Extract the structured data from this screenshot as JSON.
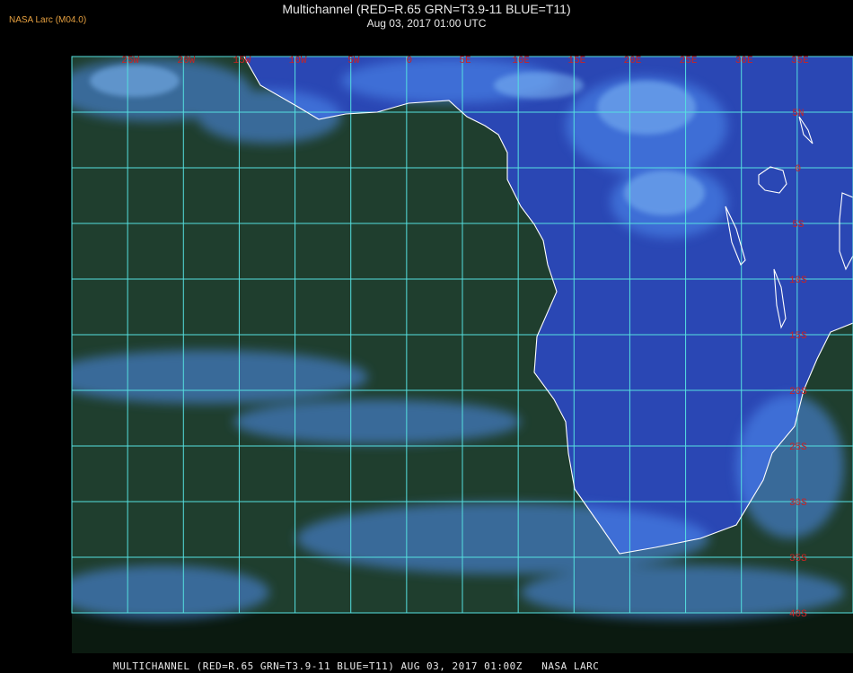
{
  "header": {
    "brand": "NASA Larc (M04.0)",
    "title": "Multichannel (RED=R.65 GRN=T3.9-11 BLUE=T11)",
    "datetime": "Aug 03, 2017 01:00 UTC"
  },
  "footer": {
    "caption": "MULTICHANNEL (RED=R.65 GRN=T3.9-11 BLUE=T11) AUG 03, 2017 01:00Z   NASA LARC"
  },
  "map": {
    "projection": "lat-lon",
    "lon_range": [
      -30,
      40
    ],
    "lat_range": [
      -40,
      10
    ],
    "grid_color": "#55e0e0",
    "coast_color": "#ffffff",
    "label_color": "#cc2222",
    "lon_labels": [
      "25W",
      "20W",
      "15W",
      "10W",
      "5W",
      "0",
      "5E",
      "10E",
      "15E",
      "20E",
      "25E",
      "30E",
      "35E"
    ],
    "lat_labels": [
      "5N",
      "0",
      "5S",
      "10S",
      "15S",
      "20S",
      "25S",
      "30S",
      "35S",
      "40S"
    ],
    "palette": {
      "ocean": "#1f3e2e",
      "land": "#2a47b4",
      "cloud": "#4f8ff2",
      "cloud_bright": "#7fb8f4"
    }
  }
}
